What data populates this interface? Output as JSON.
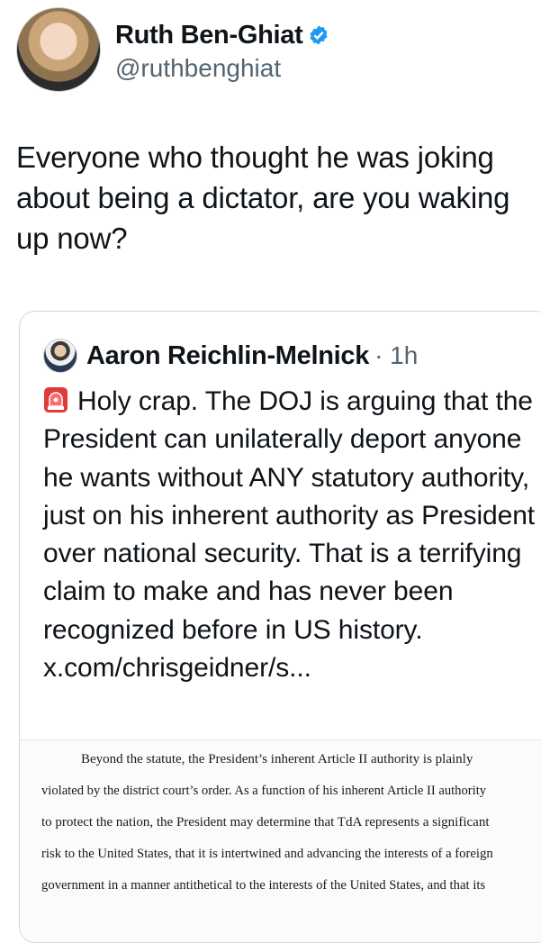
{
  "author": {
    "display_name": "Ruth Ben-Ghiat",
    "handle": "@ruthbenghiat",
    "avatar_icon": "profile-photo",
    "verified_icon": "verified-badge-icon",
    "verified_color": "#1d9bf0"
  },
  "tweet": {
    "text": "Everyone who thought he was joking about being a dictator, are you waking up now?"
  },
  "quoted": {
    "display_name": "Aaron Reichlin-Melnick",
    "time": "· 1h",
    "emoji_icon": "police-siren-icon",
    "text": "Holy crap. The DOJ is arguing that the President can unilaterally deport anyone he wants without ANY statutory authority, just on his inherent authority as President over national security.  That is a terrifying claim to make and has never been recognized before in US history. x.com/chrisgeidner/s...",
    "document_lines": [
      "Beyond the statute, the President’s inherent Article II authority is plainly",
      "violated by the district court’s order.  As a function of his inherent Article II authority",
      "to protect the nation, the President may determine that TdA represents a significant",
      "risk to the United States, that it is intertwined and advancing the interests of a foreign",
      "government in a manner antithetical to the interests of the United States, and that its"
    ]
  }
}
